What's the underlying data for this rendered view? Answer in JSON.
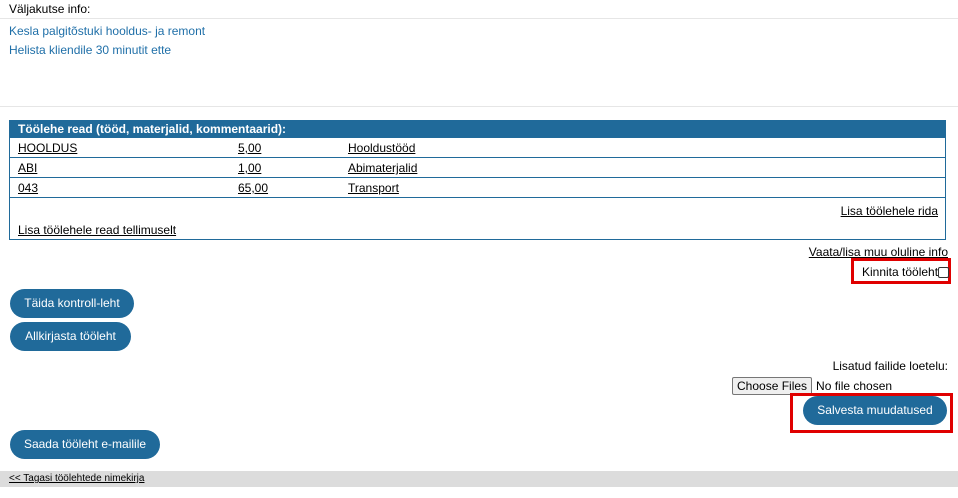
{
  "challenge_info": {
    "header": "Väljakutse info:",
    "lines": [
      "Kesla palgitõstuki hooldus- ja remont",
      "Helista kliendile 30 minutit ette"
    ]
  },
  "worksheet_rows": {
    "title": "Töölehe read (tööd, materjalid, kommentaarid):",
    "rows": [
      {
        "code": "HOOLDUS",
        "amount": "5,00",
        "name": "Hooldustööd"
      },
      {
        "code": "ABI",
        "amount": "1,00",
        "name": "Abimaterjalid"
      },
      {
        "code": "043",
        "amount": "65,00",
        "name": "Transport"
      }
    ],
    "add_row_link": "Lisa töölehele rida",
    "add_from_order_link": "Lisa töölehele read tellimuselt"
  },
  "more_info_link": "Vaata/lisa muu oluline info",
  "confirm": {
    "label": "Kinnita tööleht",
    "checked": false
  },
  "buttons": {
    "control_sheet": "Täida kontroll-leht",
    "sign": "Allkirjasta tööleht",
    "save": "Salvesta muudatused",
    "email": "Saada tööleht e-mailile"
  },
  "files": {
    "label": "Lisatud failide loetelu:",
    "choose_button": "Choose Files",
    "status": "No file chosen"
  },
  "back_link": "<< Tagasi töölehtede nimekirja",
  "colors": {
    "accent": "#206a9a",
    "info_text": "#1f6fa8",
    "highlight": "#e00000"
  }
}
